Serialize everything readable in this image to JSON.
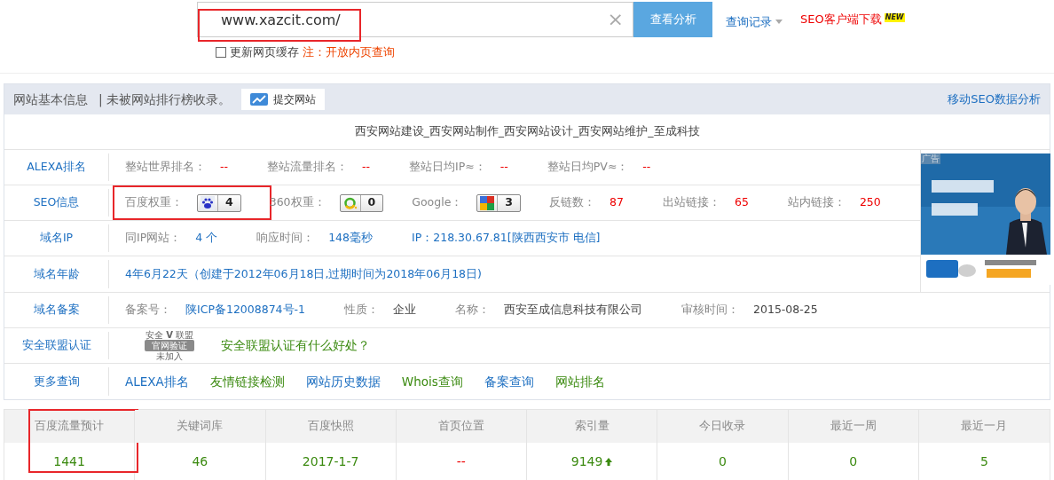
{
  "search": {
    "value": "www.xazcit.com/",
    "highlighted": true,
    "clear": "×",
    "button": "查看分析",
    "history_link": "查询记录",
    "download_link": "SEO客户端下载",
    "new_badge": "NEW"
  },
  "cache_option": {
    "label": "更新网页缓存",
    "checked": false,
    "note": "注：开放内页查询"
  },
  "panel": {
    "title": "网站基本信息",
    "subtitle": "| 未被网站排行榜收录。",
    "submit_button": "提交网站",
    "mobile_link": "移动SEO数据分析"
  },
  "site_title": "西安网站建设_西安网站制作_西安网站设计_西安网站维护_至成科技",
  "ad": {
    "kind": "picture",
    "tag": "广告"
  },
  "rows": [
    {
      "label": "ALEXA排名",
      "items": [
        {
          "kind": "pair",
          "label": "整站世界排名：",
          "value": "--",
          "color": "#ee0000"
        },
        {
          "kind": "pair",
          "label": "整站流量排名：",
          "value": "--",
          "color": "#ee0000"
        },
        {
          "kind": "pair",
          "label": "整站日均IP≈：",
          "value": "--",
          "color": "#ee0000"
        },
        {
          "kind": "pair",
          "label": "整站日均PV≈：",
          "value": "--",
          "color": "#ee0000"
        }
      ]
    },
    {
      "label": "SEO信息",
      "items": [
        {
          "kind": "pawbadge",
          "label": "百度权重：",
          "value": "4",
          "highlighted": true
        },
        {
          "kind": "ringbadge",
          "label": "360权重：",
          "value": "0",
          "highlighted": false
        },
        {
          "kind": "blockbadge",
          "label": "Google：",
          "value": "3",
          "highlighted": false
        },
        {
          "kind": "pair",
          "label": "反链数：",
          "value": "87",
          "color": "#ee0000"
        },
        {
          "kind": "pair",
          "label": "出站链接：",
          "value": "65",
          "color": "#ee0000"
        },
        {
          "kind": "pair",
          "label": "站内链接：",
          "value": "250",
          "color": "#ee0000"
        }
      ]
    },
    {
      "label": "域名IP",
      "items": [
        {
          "kind": "pair",
          "label": "同IP网站：",
          "value": "4 个",
          "color": "#1d6fc1"
        },
        {
          "kind": "pair",
          "label": "响应时间：",
          "value": "148毫秒",
          "color": "#1d6fc1"
        },
        {
          "kind": "text",
          "value": "IP：218.30.67.81[陕西西安市 电信]",
          "color": "#1d6fc1"
        }
      ]
    },
    {
      "label": "域名年龄",
      "items": [
        {
          "kind": "text",
          "value": "4年6月22天（创建于2012年06月18日,过期时间为2018年06月18日)",
          "color": "#1d6fc1"
        }
      ]
    },
    {
      "label": "域名备案",
      "items": [
        {
          "kind": "pair",
          "label": "备案号：",
          "value": "陕ICP备12008874号-1",
          "color": "#1d6fc1"
        },
        {
          "kind": "pair",
          "label": "性质：",
          "value": "企业",
          "color": "#444444"
        },
        {
          "kind": "pair",
          "label": "名称：",
          "value": "西安至成信息科技有限公司",
          "color": "#444444"
        },
        {
          "kind": "pair",
          "label": "审核时间：",
          "value": "2015-08-25",
          "color": "#444444"
        }
      ]
    },
    {
      "label": "安全联盟认证",
      "items": [
        {
          "kind": "seal",
          "top": "安全",
          "mark": "V",
          "top_right": "联盟",
          "main": "官网验证",
          "bottom": "未加入"
        },
        {
          "kind": "link",
          "value": "安全联盟认证有什么好处？",
          "color": "#3b8a10"
        }
      ]
    },
    {
      "label": "更多查询",
      "items": [
        {
          "kind": "link",
          "value": "ALEXA排名",
          "color": "#1d6fc1"
        },
        {
          "kind": "link",
          "value": "友情链接检测",
          "color": "#3b8a10"
        },
        {
          "kind": "link",
          "value": "网站历史数据",
          "color": "#1d6fc1"
        },
        {
          "kind": "link",
          "value": "Whois查询",
          "color": "#3b8a10"
        },
        {
          "kind": "link",
          "value": "备案查询",
          "color": "#1d6fc1"
        },
        {
          "kind": "link",
          "value": "网站排名",
          "color": "#3b8a10"
        }
      ]
    }
  ],
  "stats": [
    {
      "heading": "百度流量预计",
      "value": "1441",
      "color": "#3b8a10",
      "highlighted": true
    },
    {
      "heading": "关键词库",
      "value": "46",
      "color": "#3b8a10",
      "highlighted": false
    },
    {
      "heading": "百度快照",
      "value": "2017-1-7",
      "color": "#3b8a10",
      "highlighted": false
    },
    {
      "heading": "首页位置",
      "value": "--",
      "color": "#ee0000",
      "highlighted": false
    },
    {
      "heading": "索引量",
      "value": "9149",
      "color": "#3b8a10",
      "rising": true,
      "highlighted": false
    },
    {
      "heading": "今日收录",
      "value": "0",
      "color": "#3b8a10",
      "highlighted": false
    },
    {
      "heading": "最近一周",
      "value": "0",
      "color": "#3b8a10",
      "highlighted": false
    },
    {
      "heading": "最近一月",
      "value": "5",
      "color": "#3b8a10",
      "highlighted": false
    }
  ]
}
